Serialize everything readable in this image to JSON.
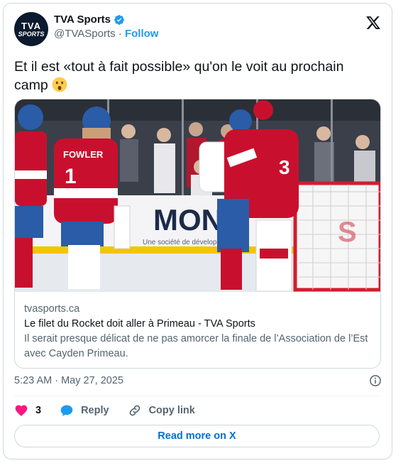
{
  "author": {
    "display_name": "TVA Sports",
    "handle": "@TVASports",
    "separator": " · ",
    "follow_label": "Follow",
    "avatar_line1": "TVA",
    "avatar_line2": "SPORTS"
  },
  "tweet": {
    "text": "Et il est «tout à fait possible» qu'on le voit au prochain camp",
    "emoji": "astonished-face"
  },
  "link_card": {
    "photo_sign_text": "MON",
    "photo_sign_subtext": "Une société de développement",
    "photo_jersey_name": "FOWLER",
    "photo_jersey_number": "1",
    "domain": "tvasports.ca",
    "title": "Le filet du Rocket doit aller à Primeau - TVA Sports",
    "description": "Il serait presque délicat de ne pas amorcer la finale de l’Association de l’Est avec Cayden Primeau."
  },
  "timestamp": "5:23 AM · May 27, 2025",
  "actions": {
    "likes_count": "3",
    "reply_label": "Reply",
    "copy_link_label": "Copy link"
  },
  "read_more_label": "Read more on X",
  "colors": {
    "accent": "#1d9bf0",
    "like": "#f91880",
    "jersey_red": "#c8102e",
    "helmet_blue": "#2a5ca8"
  },
  "icons": [
    "verified-badge-icon",
    "x-logo-icon",
    "info-icon",
    "heart-icon",
    "reply-bubble-icon",
    "link-icon"
  ]
}
